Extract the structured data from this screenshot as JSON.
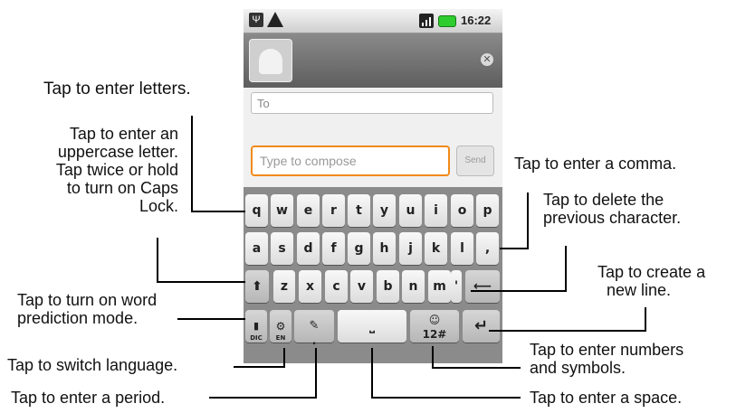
{
  "status_bar": {
    "time": "16:22"
  },
  "compose": {
    "to_placeholder": "To",
    "message_placeholder": "Type to compose",
    "send_label": "Send"
  },
  "keyboard": {
    "row1": [
      "q",
      "w",
      "e",
      "r",
      "t",
      "y",
      "u",
      "i",
      "o",
      "p"
    ],
    "row2": [
      "a",
      "s",
      "d",
      "f",
      "g",
      "h",
      "j",
      "k",
      "l",
      ","
    ],
    "row3": [
      "z",
      "x",
      "c",
      "v",
      "b",
      "n",
      "m",
      "'"
    ],
    "dic_label": "DIC",
    "lang_label": "EN",
    "period_label": ".",
    "numbers_label": "12#",
    "numbers_icon": "☺"
  },
  "callouts": {
    "letters": "Tap to enter letters.",
    "uppercase": [
      "Tap to enter an",
      "uppercase letter.",
      "Tap twice or hold",
      "to turn on Caps",
      "Lock."
    ],
    "prediction": [
      "Tap to turn on word",
      "prediction mode."
    ],
    "language": "Tap to switch language.",
    "period": "Tap to enter a period.",
    "comma": "Tap to enter a comma.",
    "delete": [
      "Tap to delete the",
      "previous character."
    ],
    "newline": [
      "Tap to create a",
      "new line."
    ],
    "numbers": [
      "Tap to enter numbers",
      "and symbols."
    ],
    "space": "Tap to enter a space."
  }
}
